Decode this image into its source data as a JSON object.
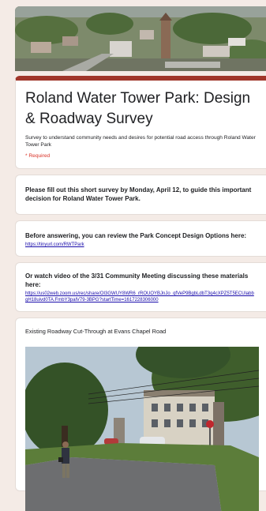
{
  "form": {
    "title": "Roland Water Tower Park: Design & Roadway Survey",
    "description": "Survey to understand community needs and desires for potential road access through Roland Water Tower Park",
    "required": "* Required"
  },
  "sections": {
    "deadline": "Please fill out this short survey by Monday, April 12, to guide this important decision for Roland Water Tower Park.",
    "review_text": "Before answering, you can review the Park Concept Design Options here:",
    "review_link": "https://tinyurl.com/RWTPark",
    "video_text": "Or watch video of the 3/31 Community Meeting discussing these materials here:",
    "video_link": "https://us02web.zoom.us/rec/share/OI3GWUY8WR6_rROUOYBJnJo_qfVeP9BgbLdbT3q4cXPZ5T5ECUlabbgH18uivd0TA.FmbY3palV79-3BPG?startTime=1617228306000",
    "photo_caption": "Existing Roadway Cut-Through at Evans Chapel Road"
  },
  "colors": {
    "accent": "#a0362a",
    "background": "#f4ebe6",
    "link": "#1a0dab",
    "required": "#d93025"
  }
}
